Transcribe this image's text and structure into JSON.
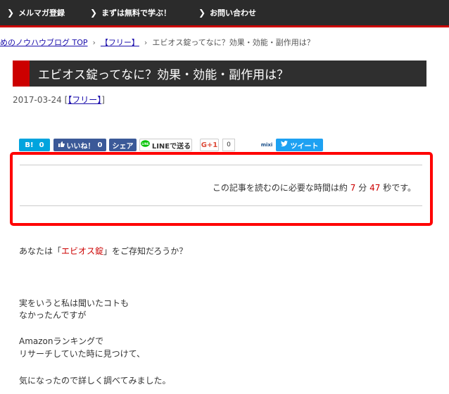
{
  "nav": {
    "items": [
      {
        "chevron": "❯",
        "label": "メルマガ登録"
      },
      {
        "chevron": "❯",
        "label": "まずは無料で学ぶ！"
      },
      {
        "chevron": "❯",
        "label": "お問い合わせ"
      }
    ]
  },
  "breadcrumb": {
    "home": "めのノウハウブログ TOP",
    "sep1": "›",
    "category": "【フリー】",
    "sep2": "›",
    "current": "エビオス錠ってなに？効果・効能・副作用は？"
  },
  "article": {
    "title": "エビオス錠ってなに？効果・効能・副作用は？",
    "date": "2017-03-24",
    "category_open": "[",
    "category": "【フリー】",
    "category_close": "]"
  },
  "share": {
    "hatena_label": "B!",
    "hatena_count": "0",
    "fb_like_label": "いいね！",
    "fb_like_count": "0",
    "fb_share_label": "シェア",
    "line_label": "LINEで送る",
    "gplus_label": "G+1",
    "gplus_count": "0",
    "mixi_label": "mixi",
    "tweet_label": "ツイート"
  },
  "reading_time": {
    "prefix": "この記事を読むのに必要な時間は約",
    "minutes": "7",
    "min_unit": "分",
    "seconds": "47",
    "sec_unit": "秒です。"
  },
  "body": {
    "p1_before": "あなたは「",
    "p1_highlight": "エビオス錠",
    "p1_after": "」をご存知だろうか？",
    "p2_line1": "実をいうと私は聞いたコトも",
    "p2_line2": "なかったんですが",
    "p3_line1": "Amazonランキングで",
    "p3_line2": "リサーチしていた時に見つけて、",
    "p4_line1": "気になったので詳しく調べてみました。"
  },
  "colors": {
    "accent": "#cc0000",
    "nav_bg": "#2b2b2b",
    "title_bg": "#2f2f2f",
    "link": "#1a0dab",
    "highlight_box": "#ff0000",
    "hatena": "#00a4de",
    "facebook": "#3b5998",
    "line": "#00c300",
    "gplus": "#dd4b39",
    "twitter": "#1da1f2"
  }
}
